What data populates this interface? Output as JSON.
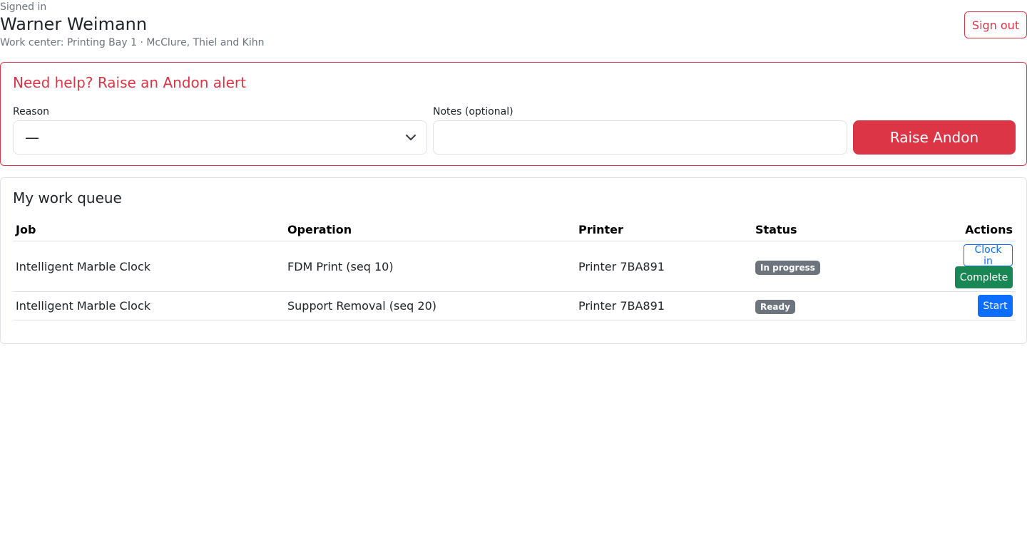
{
  "header": {
    "signed_in_label": "Signed in",
    "user_name": "Warner Weimann",
    "work_center": "Work center: Printing Bay 1 · McClure, Thiel and Kihn",
    "sign_out_label": "Sign out"
  },
  "andon": {
    "title": "Need help? Raise an Andon alert",
    "reason_label": "Reason",
    "reason_value": "—",
    "notes_label": "Notes (optional)",
    "notes_value": "",
    "notes_placeholder": "",
    "raise_label": "Raise Andon"
  },
  "queue": {
    "title": "My work queue",
    "columns": {
      "job": "Job",
      "operation": "Operation",
      "printer": "Printer",
      "status": "Status",
      "actions": "Actions"
    },
    "rows": [
      {
        "job": "Intelligent Marble Clock",
        "operation": "FDM Print (seq 10)",
        "printer": "Printer 7BA891",
        "status": "In progress",
        "actions": [
          "Clock in",
          "Complete"
        ]
      },
      {
        "job": "Intelligent Marble Clock",
        "operation": "Support Removal (seq 20)",
        "printer": "Printer 7BA891",
        "status": "Ready",
        "actions": [
          "Start"
        ]
      }
    ]
  },
  "colors": {
    "danger": "#dc3545",
    "primary": "#0d6efd",
    "success": "#198754",
    "secondary": "#6c757d",
    "border": "#dee2e6"
  },
  "icons": {
    "select_chevron": "chevron-down-icon"
  }
}
